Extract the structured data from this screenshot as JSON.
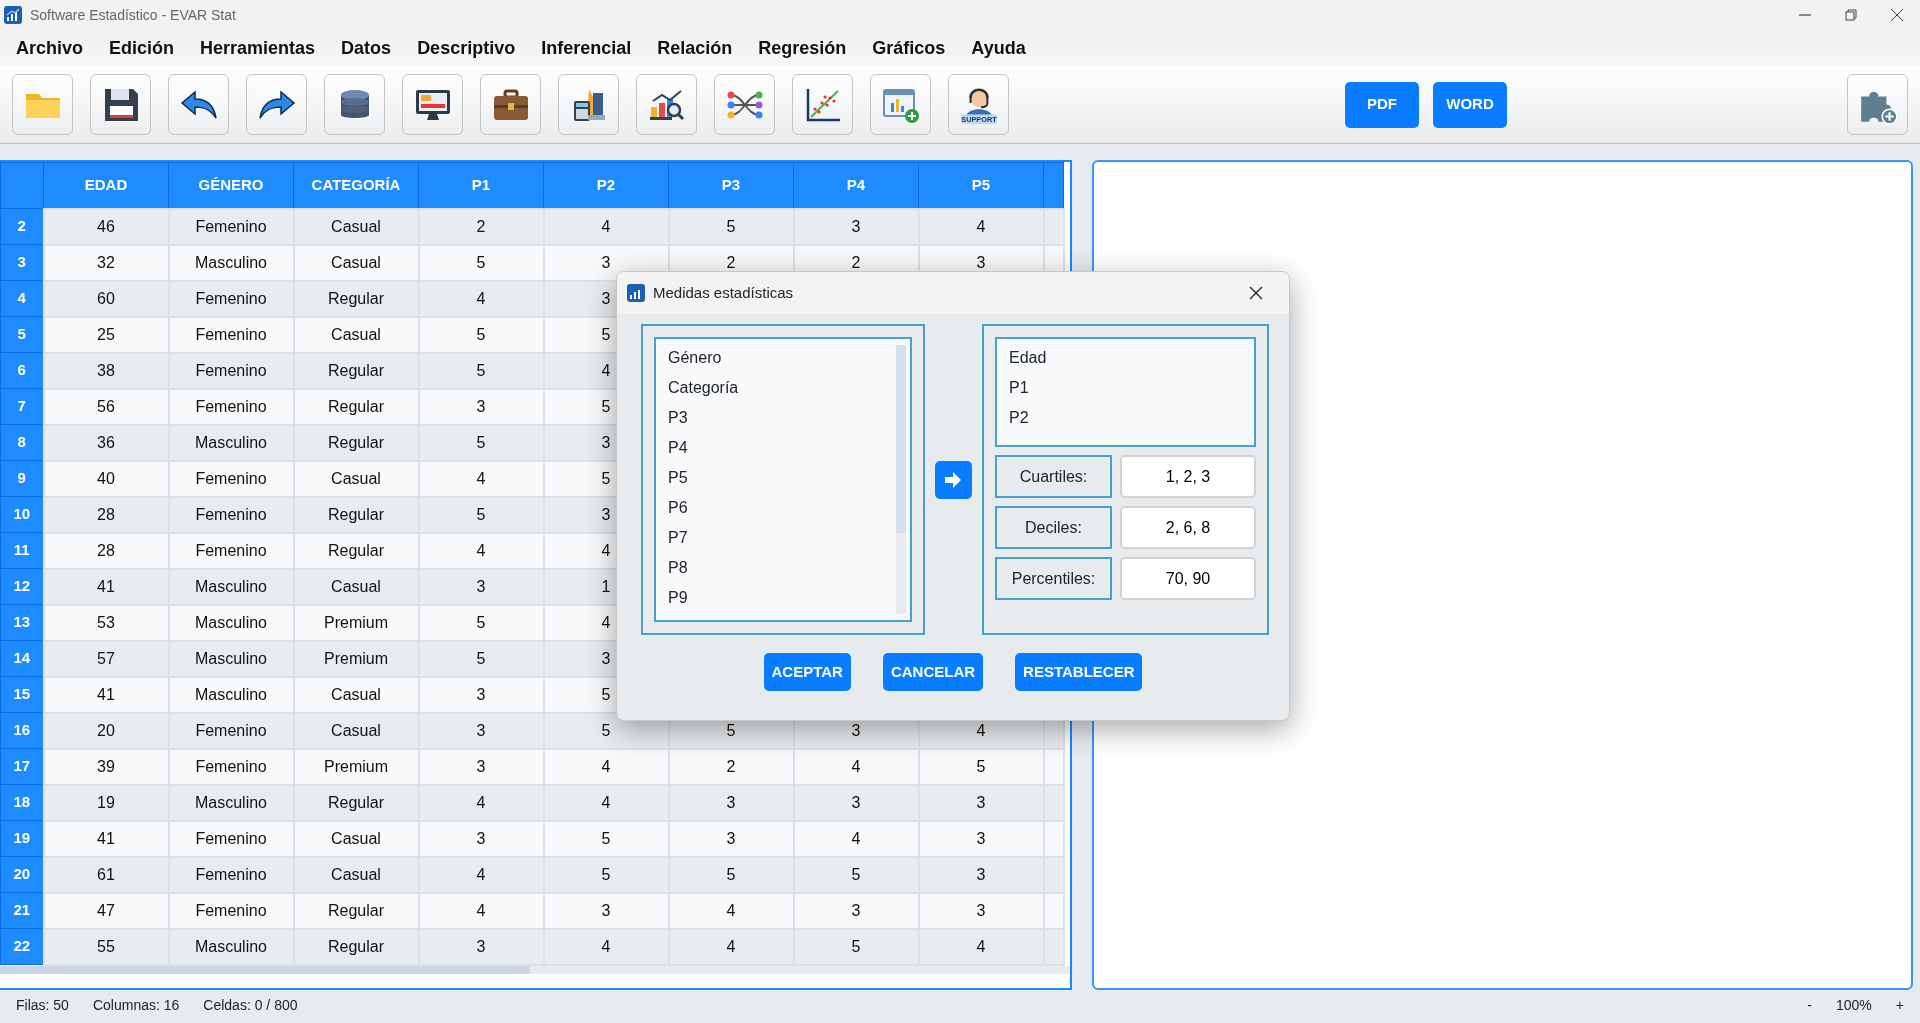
{
  "window": {
    "title": "Software Estadístico - EVAR Stat"
  },
  "menu": [
    "Archivo",
    "Edición",
    "Herramientas",
    "Datos",
    "Descriptivo",
    "Inferencial",
    "Relación",
    "Regresión",
    "Gráficos",
    "Ayuda"
  ],
  "toolbar": {
    "tools": [
      {
        "kind": "folder"
      },
      {
        "kind": "floppy"
      },
      {
        "kind": "undo"
      },
      {
        "kind": "redo"
      },
      {
        "kind": "database"
      },
      {
        "kind": "monitor"
      },
      {
        "kind": "briefcase"
      },
      {
        "kind": "calculator"
      },
      {
        "kind": "chartsearch"
      },
      {
        "kind": "network"
      },
      {
        "kind": "scatter"
      },
      {
        "kind": "windowchart"
      },
      {
        "kind": "support"
      }
    ],
    "support_label": "SUPPORT",
    "export_buttons": [
      "PDF",
      "WORD"
    ]
  },
  "table": {
    "columns": [
      "EDAD",
      "GÉNERO",
      "CATEGORÍA",
      "P1",
      "P2",
      "P3",
      "P4",
      "P5"
    ],
    "rows": [
      {
        "number": "2",
        "cells": [
          "46",
          "Femenino",
          "Casual",
          "2",
          "4",
          "5",
          "3",
          "4"
        ]
      },
      {
        "number": "3",
        "cells": [
          "32",
          "Masculino",
          "Casual",
          "5",
          "3",
          "2",
          "2",
          "3"
        ]
      },
      {
        "number": "4",
        "cells": [
          "60",
          "Femenino",
          "Regular",
          "4",
          "3",
          null,
          null,
          null
        ]
      },
      {
        "number": "5",
        "cells": [
          "25",
          "Femenino",
          "Casual",
          "5",
          "5",
          null,
          null,
          null
        ]
      },
      {
        "number": "6",
        "cells": [
          "38",
          "Femenino",
          "Regular",
          "5",
          "4",
          null,
          null,
          null
        ]
      },
      {
        "number": "7",
        "cells": [
          "56",
          "Femenino",
          "Regular",
          "3",
          "5",
          null,
          null,
          null
        ]
      },
      {
        "number": "8",
        "cells": [
          "36",
          "Masculino",
          "Regular",
          "5",
          "3",
          null,
          null,
          null
        ]
      },
      {
        "number": "9",
        "cells": [
          "40",
          "Femenino",
          "Casual",
          "4",
          "5",
          null,
          null,
          null
        ]
      },
      {
        "number": "10",
        "cells": [
          "28",
          "Femenino",
          "Regular",
          "5",
          "3",
          null,
          null,
          null
        ]
      },
      {
        "number": "11",
        "cells": [
          "28",
          "Femenino",
          "Regular",
          "4",
          "4",
          null,
          null,
          null
        ]
      },
      {
        "number": "12",
        "cells": [
          "41",
          "Masculino",
          "Casual",
          "3",
          "1",
          null,
          null,
          null
        ]
      },
      {
        "number": "13",
        "cells": [
          "53",
          "Masculino",
          "Premium",
          "5",
          "4",
          null,
          null,
          null
        ]
      },
      {
        "number": "14",
        "cells": [
          "57",
          "Masculino",
          "Premium",
          "5",
          "3",
          null,
          null,
          null
        ]
      },
      {
        "number": "15",
        "cells": [
          "41",
          "Masculino",
          "Casual",
          "3",
          "5",
          null,
          null,
          null
        ]
      },
      {
        "number": "16",
        "cells": [
          "20",
          "Femenino",
          "Casual",
          "3",
          "5",
          "5",
          "3",
          "4"
        ]
      },
      {
        "number": "17",
        "cells": [
          "39",
          "Femenino",
          "Premium",
          "3",
          "4",
          "2",
          "4",
          "5"
        ]
      },
      {
        "number": "18",
        "cells": [
          "19",
          "Masculino",
          "Regular",
          "4",
          "4",
          "3",
          "3",
          "3"
        ]
      },
      {
        "number": "19",
        "cells": [
          "41",
          "Femenino",
          "Casual",
          "3",
          "5",
          "3",
          "4",
          "3"
        ]
      },
      {
        "number": "20",
        "cells": [
          "61",
          "Femenino",
          "Casual",
          "4",
          "5",
          "5",
          "5",
          "3"
        ]
      },
      {
        "number": "21",
        "cells": [
          "47",
          "Femenino",
          "Regular",
          "4",
          "3",
          "4",
          "3",
          "3"
        ]
      },
      {
        "number": "22",
        "cells": [
          "55",
          "Masculino",
          "Regular",
          "3",
          "4",
          "4",
          "5",
          "4"
        ]
      }
    ]
  },
  "dialog": {
    "title": "Medidas estadísticas",
    "available": [
      "Género",
      "Categoría",
      "P3",
      "P4",
      "P5",
      "P6",
      "P7",
      "P8",
      "P9"
    ],
    "chosen": [
      "Edad",
      "P1",
      "P2"
    ],
    "fields": [
      {
        "label": "Cuartiles:",
        "value": "1, 2, 3"
      },
      {
        "label": "Deciles:",
        "value": "2, 6, 8"
      },
      {
        "label": "Percentiles:",
        "value": "70, 90"
      }
    ],
    "buttons": [
      "ACEPTAR",
      "CANCELAR",
      "RESTABLECER"
    ]
  },
  "status_bar": {
    "rows": "Filas: 50",
    "columns": "Columnas: 16",
    "cells": "Celdas: 0 / 800",
    "zoom_out": "-",
    "zoom": "100%",
    "zoom_in": "+"
  }
}
